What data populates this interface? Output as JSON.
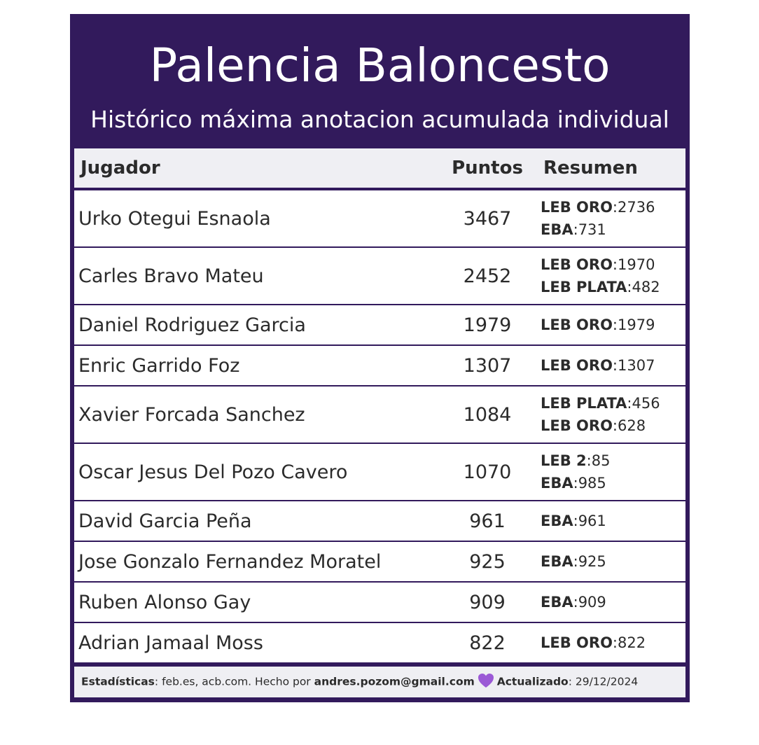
{
  "header": {
    "title": "Palencia Baloncesto",
    "subtitle": "Histórico máxima anotacion acumulada individual"
  },
  "table": {
    "columns": {
      "player": "Jugador",
      "points": "Puntos",
      "summary": "Resumen"
    },
    "rows": [
      {
        "player": "Urko Otegui Esnaola",
        "points": "3467",
        "summary": [
          {
            "league": "LEB ORO",
            "points": "2736"
          },
          {
            "league": "EBA",
            "points": "731"
          }
        ]
      },
      {
        "player": "Carles Bravo Mateu",
        "points": "2452",
        "summary": [
          {
            "league": "LEB ORO",
            "points": "1970"
          },
          {
            "league": "LEB PLATA",
            "points": "482"
          }
        ]
      },
      {
        "player": "Daniel Rodriguez Garcia",
        "points": "1979",
        "summary": [
          {
            "league": "LEB ORO",
            "points": "1979"
          }
        ]
      },
      {
        "player": "Enric Garrido Foz",
        "points": "1307",
        "summary": [
          {
            "league": "LEB ORO",
            "points": "1307"
          }
        ]
      },
      {
        "player": "Xavier Forcada Sanchez",
        "points": "1084",
        "summary": [
          {
            "league": "LEB PLATA",
            "points": "456"
          },
          {
            "league": "LEB ORO",
            "points": "628"
          }
        ]
      },
      {
        "player": "Oscar Jesus Del Pozo Cavero",
        "points": "1070",
        "summary": [
          {
            "league": "LEB 2",
            "points": "85"
          },
          {
            "league": "EBA",
            "points": "985"
          }
        ]
      },
      {
        "player": "David Garcia Peña",
        "points": "961",
        "summary": [
          {
            "league": "EBA",
            "points": "961"
          }
        ]
      },
      {
        "player": "Jose Gonzalo Fernandez Moratel",
        "points": "925",
        "summary": [
          {
            "league": "EBA",
            "points": "925"
          }
        ]
      },
      {
        "player": "Ruben Alonso Gay",
        "points": "909",
        "summary": [
          {
            "league": "EBA",
            "points": "909"
          }
        ]
      },
      {
        "player": "Adrian Jamaal Moss",
        "points": "822",
        "summary": [
          {
            "league": "LEB ORO",
            "points": "822"
          }
        ]
      }
    ]
  },
  "footer": {
    "stats_label": "Estadísticas",
    "stats_sources": ": feb.es, acb.com. Hecho por ",
    "author": "andres.pozom@gmail.com",
    "heart_icon": "purple-heart-icon",
    "updated_label": "Actualizado",
    "updated_value": ": 29/12/2024"
  },
  "colors": {
    "frame": "#321a5c",
    "header_bg": "#efeff3",
    "heart": "#9b59d6"
  }
}
